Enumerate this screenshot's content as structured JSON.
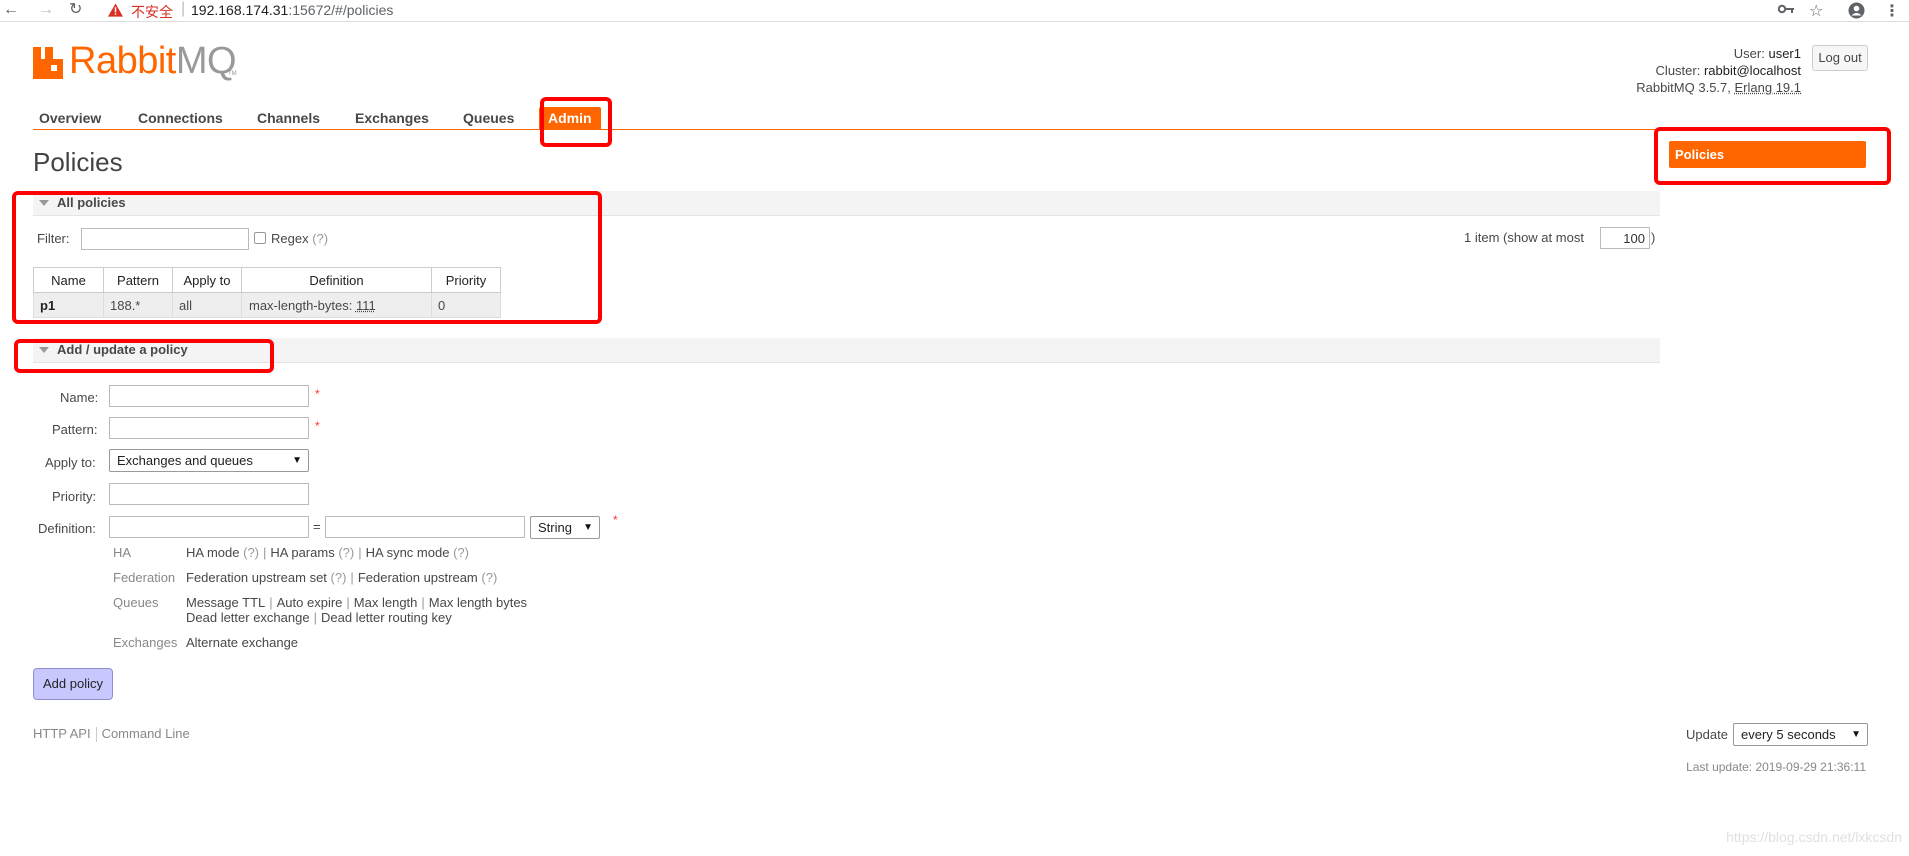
{
  "browser": {
    "insecure_label": "不安全",
    "url_host": "192.168.174.31",
    "url_rest": ":15672/#/policies"
  },
  "logo": {
    "rabbit": "Rabbit",
    "mq": "MQ",
    "tm": "TM"
  },
  "user": {
    "user_label": "User:",
    "user": "user1",
    "cluster_label": "Cluster:",
    "cluster": "rabbit@localhost",
    "version": "RabbitMQ 3.5.7,",
    "erlang": "Erlang 19.1",
    "logout": "Log out"
  },
  "tabs": [
    "Overview",
    "Connections",
    "Channels",
    "Exchanges",
    "Queues",
    "Admin"
  ],
  "sidebar": {
    "active": "Policies"
  },
  "page": {
    "title": "Policies"
  },
  "all_policies": {
    "header": "All policies",
    "filter_label": "Filter:",
    "regex_label": "Regex",
    "help": "(?)",
    "count_text": "1 item (show at most",
    "count_close": ")",
    "show_max": "100",
    "columns": [
      "Name",
      "Pattern",
      "Apply to",
      "Definition",
      "Priority"
    ],
    "rows": [
      {
        "name": "p1",
        "pattern": "188.*",
        "apply_to": "all",
        "def_key": "max-length-bytes:",
        "def_val": "111",
        "priority": "0"
      }
    ]
  },
  "add_policy": {
    "header": "Add / update a policy",
    "name_label": "Name:",
    "pattern_label": "Pattern:",
    "apply_label": "Apply to:",
    "apply_value": "Exchanges and queues",
    "priority_label": "Priority:",
    "definition_label": "Definition:",
    "eq": "=",
    "type_value": "String",
    "req": "*",
    "categories": {
      "ha": "HA",
      "federation": "Federation",
      "queues": "Queues",
      "exchanges": "Exchanges"
    },
    "ha_links": [
      "HA mode",
      "HA params",
      "HA sync mode"
    ],
    "federation_links": [
      "Federation upstream set",
      "Federation upstream"
    ],
    "queues_links_1": [
      "Message TTL",
      "Auto expire",
      "Max length",
      "Max length bytes"
    ],
    "queues_links_2": [
      "Dead letter exchange",
      "Dead letter routing key"
    ],
    "exchanges_links": [
      "Alternate exchange"
    ],
    "submit": "Add policy"
  },
  "footer": {
    "http_api": "HTTP API",
    "command_line": "Command Line",
    "update_label": "Update",
    "update_value": "every 5 seconds",
    "last_update": "Last update: 2019-09-29 21:36:11",
    "watermark": "https://blog.csdn.net/lxkcsdn"
  },
  "colors": {
    "accent": "#ff6600",
    "highlight": "#ff0000",
    "button": "#c8c8ff"
  }
}
